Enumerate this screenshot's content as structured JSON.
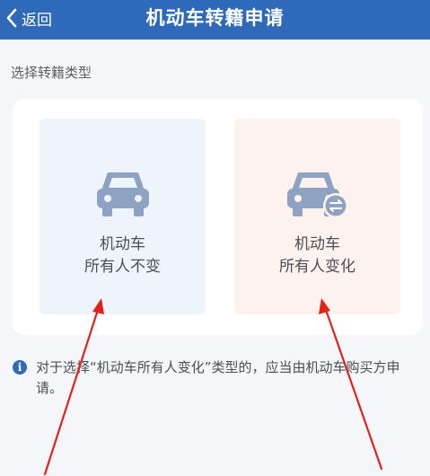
{
  "header": {
    "back_label": "返回",
    "title": "机动车转籍申请"
  },
  "section_label": "选择转籍类型",
  "options": [
    {
      "line1": "机动车",
      "line2": "所有人不变",
      "icon": "car-icon"
    },
    {
      "line1": "机动车",
      "line2": "所有人变化",
      "icon": "car-transfer-icon"
    }
  ],
  "notice": {
    "icon": "info-icon",
    "text": "对于选择“机动车所有人变化”类型的，应当由机动车购买方申请。"
  },
  "colors": {
    "header_bg": "#2f6ab8",
    "card_same_bg": "#eef4fc",
    "card_change_bg": "#fdf2ee",
    "icon_color": "#8ea3c4",
    "annotation_arrow": "#e0221b"
  }
}
